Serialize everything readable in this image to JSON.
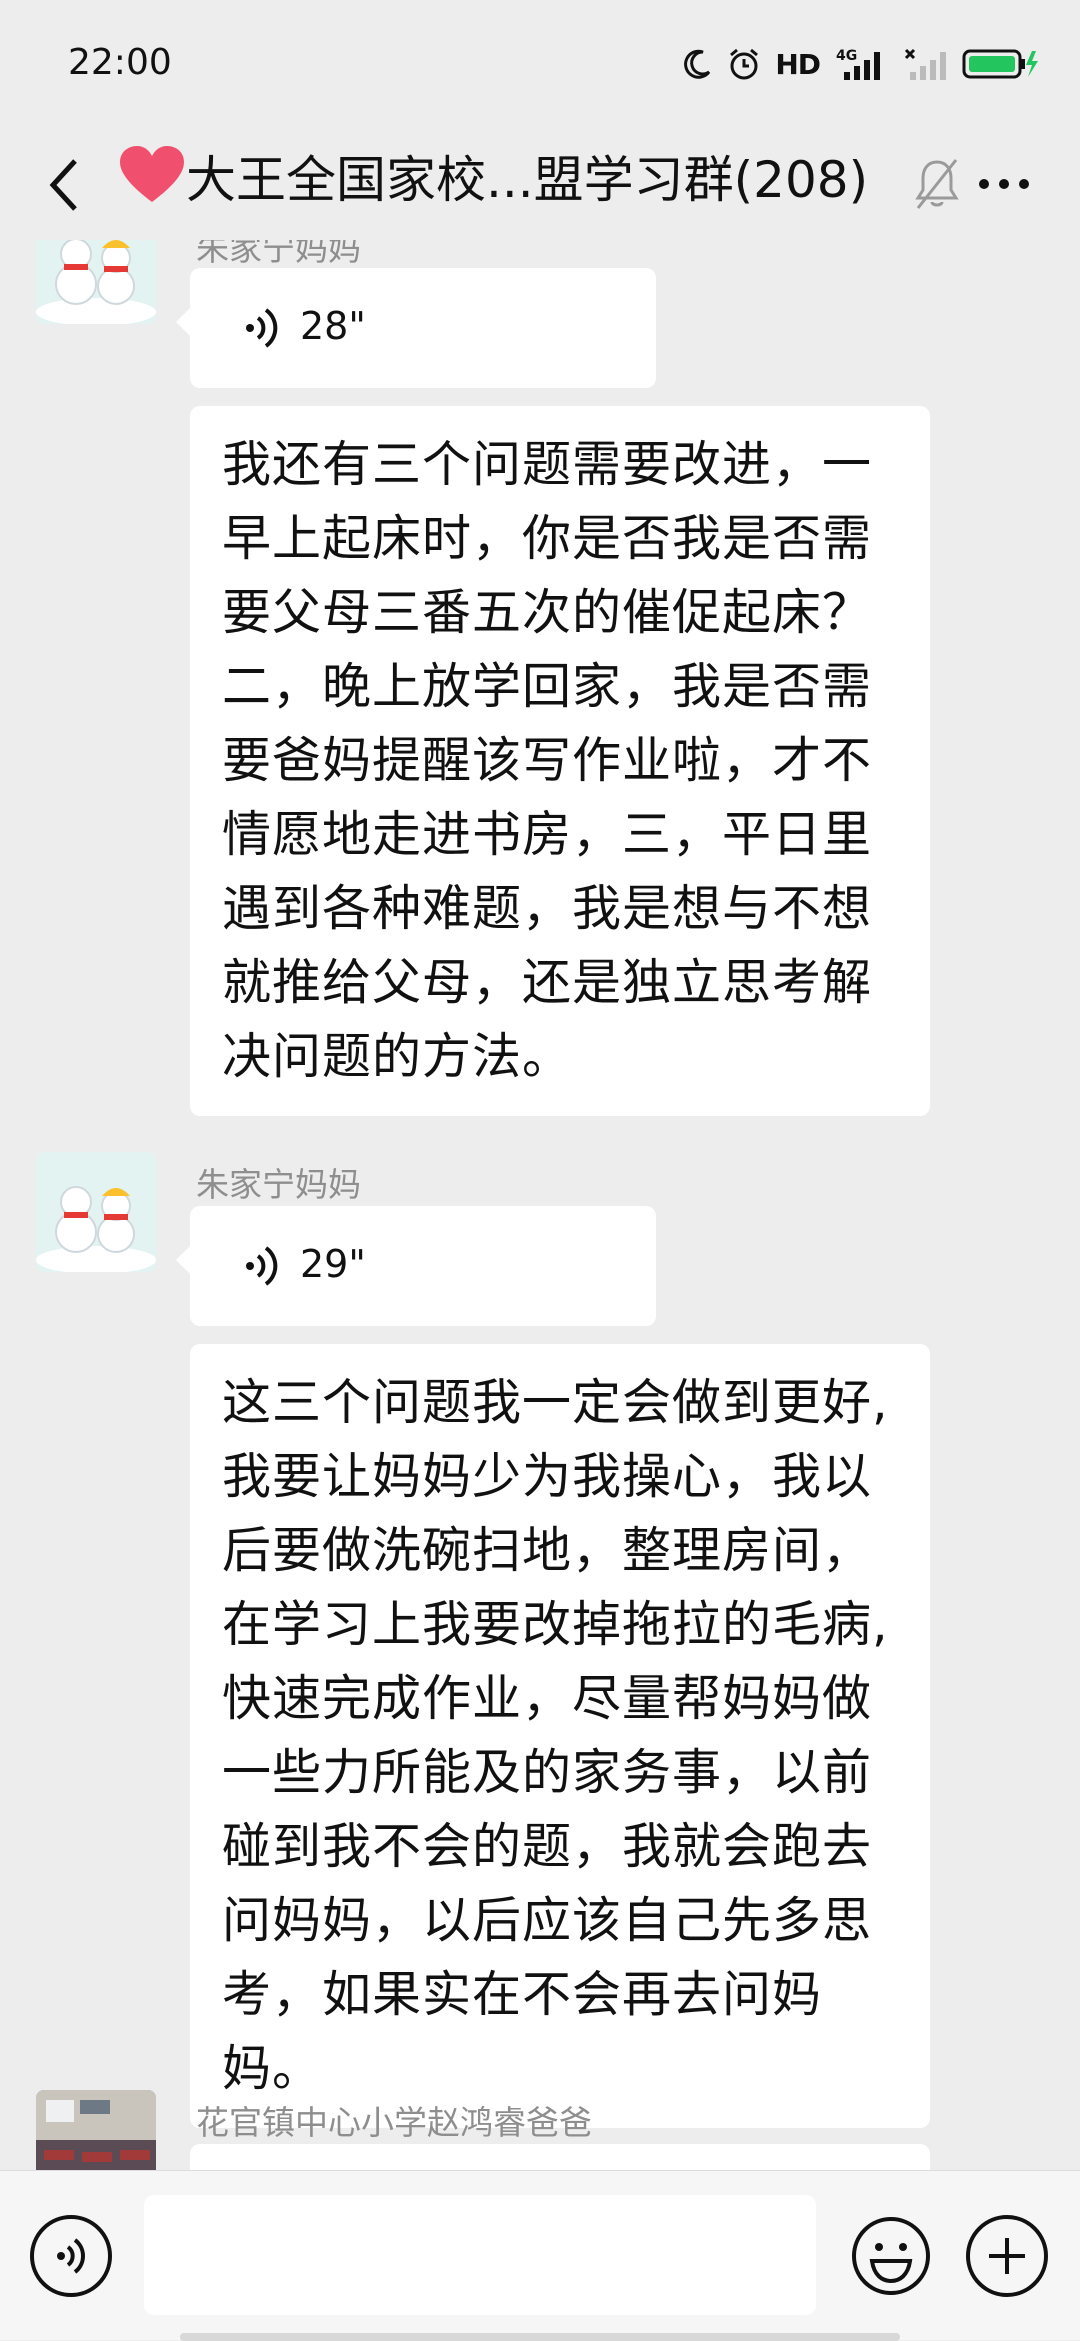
{
  "status_bar": {
    "time": "22:00",
    "hd_label": "HD",
    "network_label": "4G",
    "battery_color": "#22c55e"
  },
  "header": {
    "title": "大王全国家校...盟学习群(208)",
    "icons": [
      "back-icon",
      "heart-icon",
      "mute-bell-icon",
      "more-icon"
    ]
  },
  "messages": [
    {
      "sender": "朱家宁妈妈",
      "voice_duration": "28\"",
      "text_lines": [
        "我还有三个问题需要改进，一",
        "早上起床时，你是否我是否需",
        "要父母三番五次的催促起床？",
        "二，晚上放学回家，我是否需",
        "要爸妈提醒该写作业啦，才不",
        "情愿地走进书房，三，平日里",
        "遇到各种难题，我是想与不想",
        "就推给父母，还是独立思考解",
        "决问题的方法。"
      ]
    },
    {
      "sender": "朱家宁妈妈",
      "voice_duration": "29\"",
      "text_lines": [
        "这三个问题我一定会做到更好,",
        "我要让妈妈少为我操心，我以",
        "后要做洗碗扫地，整理房间，",
        "在学习上我要改掉拖拉的毛病,",
        "快速完成作业，尽量帮妈妈做",
        "一些力所能及的家务事，以前",
        "碰到我不会的题，我就会跑去",
        "问妈妈，以后应该自己先多思",
        "考，如果实在不会再去问妈妈。"
      ]
    },
    {
      "sender": "花官镇中心小学赵鸿睿爸爸"
    }
  ],
  "input_bar": {
    "placeholder": "",
    "icons": [
      "voice-toggle-icon",
      "emoji-icon",
      "plus-icon"
    ]
  }
}
